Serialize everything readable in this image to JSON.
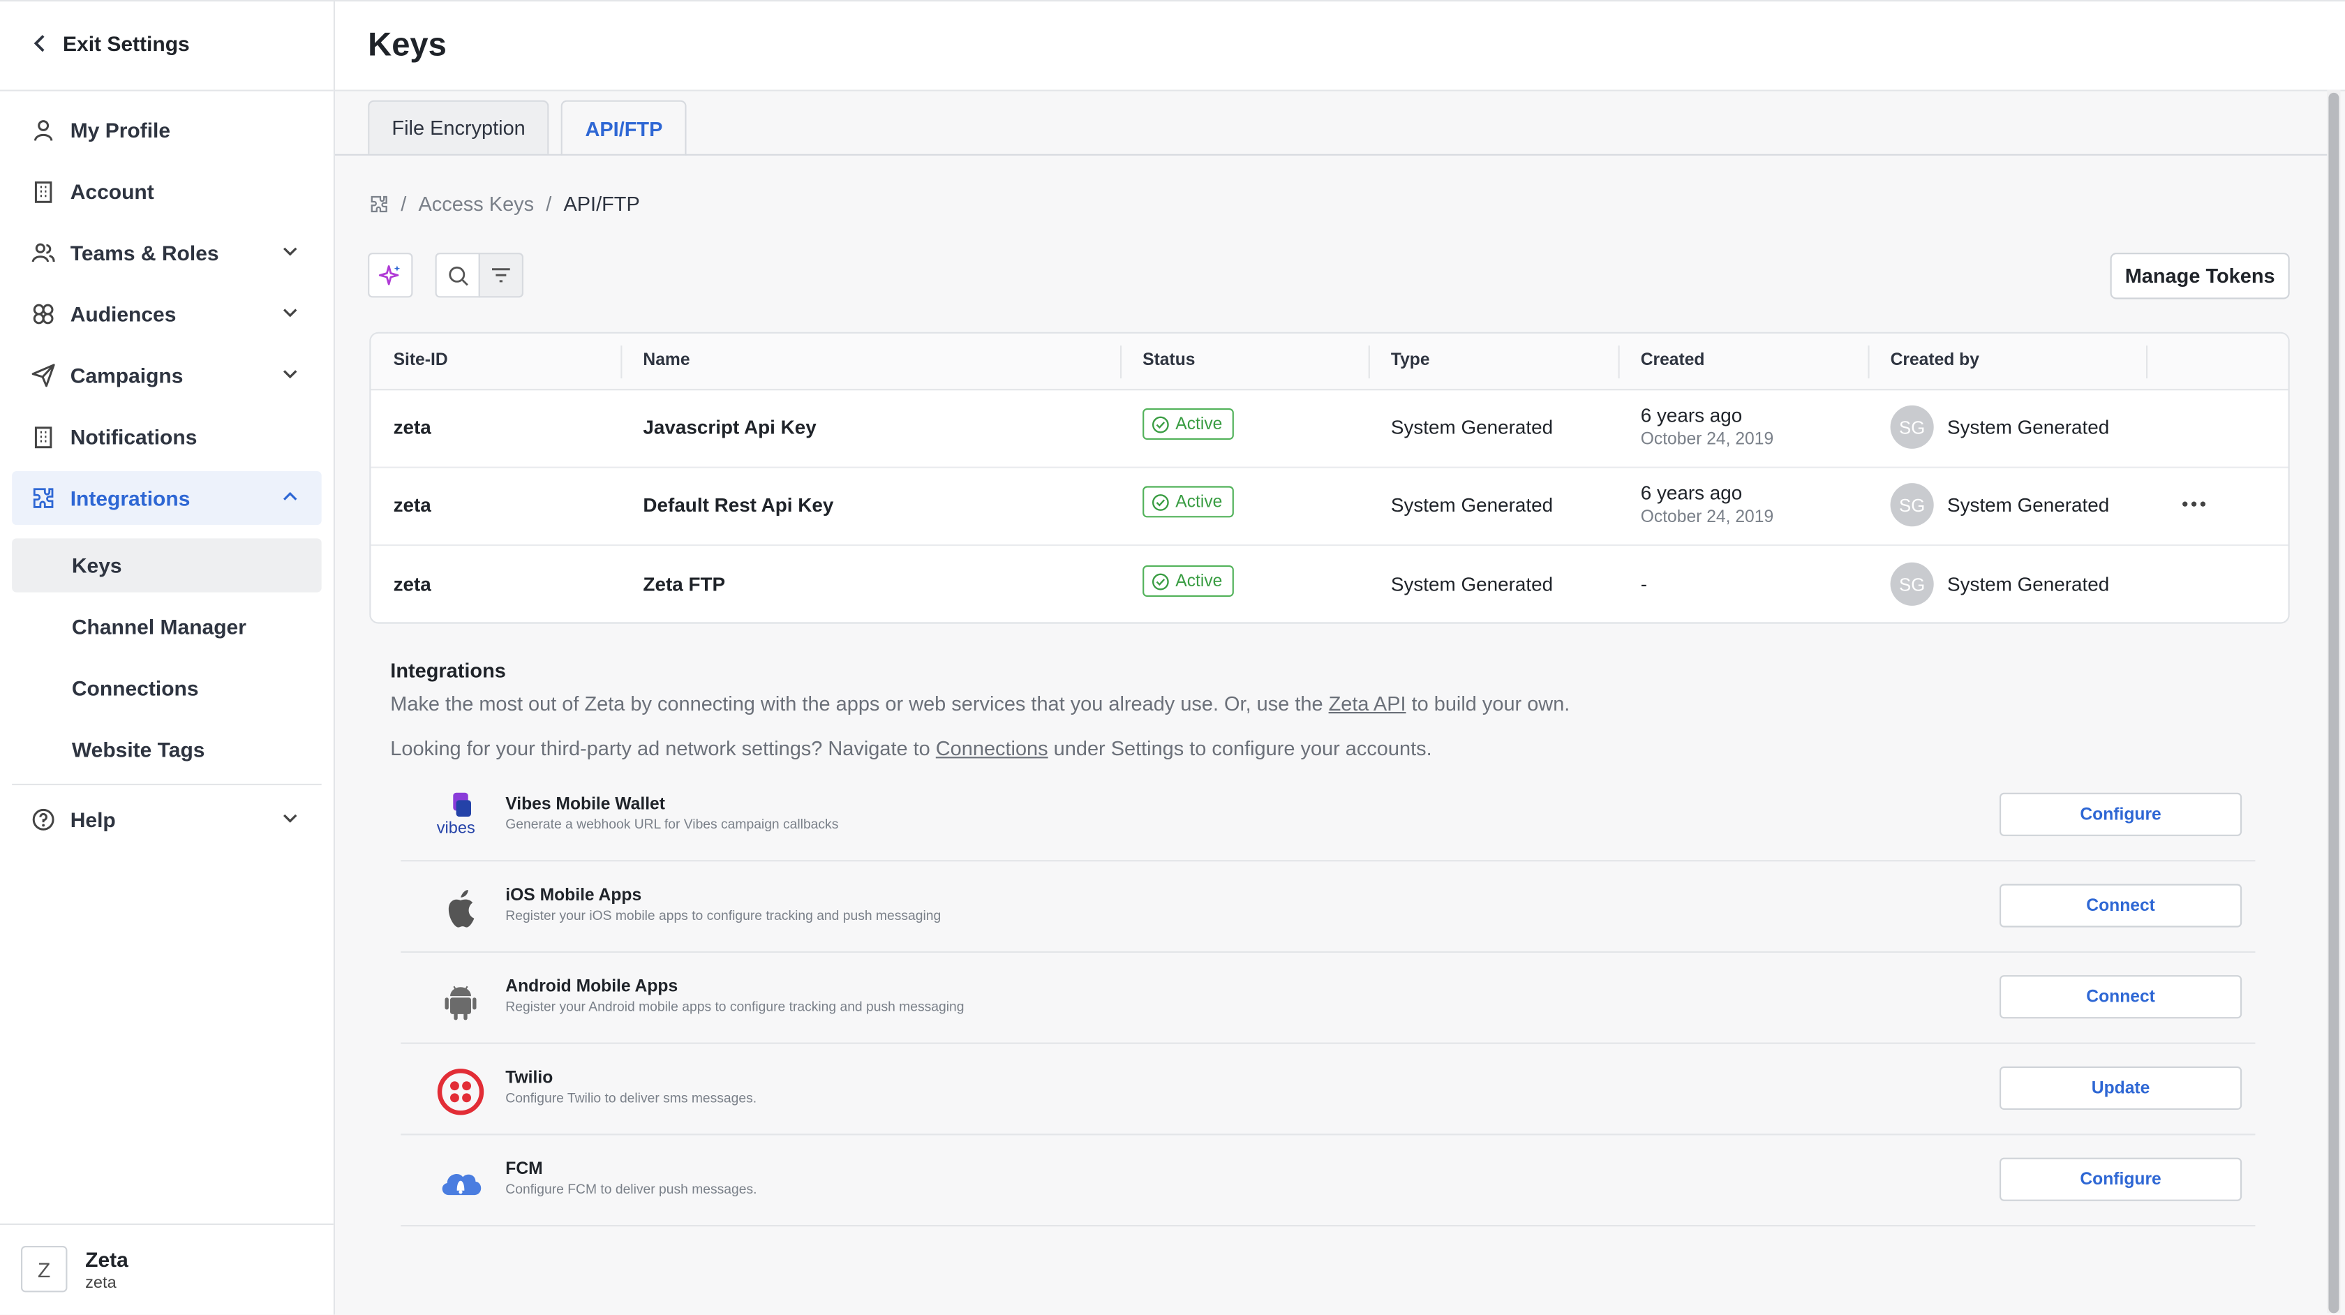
{
  "sidebar": {
    "exit_label": "Exit Settings",
    "items": [
      {
        "label": "My Profile",
        "icon": "user-icon"
      },
      {
        "label": "Account",
        "icon": "building-icon"
      },
      {
        "label": "Teams & Roles",
        "icon": "users-icon"
      },
      {
        "label": "Audiences",
        "icon": "audiences-icon"
      },
      {
        "label": "Campaigns",
        "icon": "send-icon"
      },
      {
        "label": "Notifications",
        "icon": "building-icon"
      },
      {
        "label": "Integrations",
        "icon": "puzzle-icon"
      }
    ],
    "sub_items": [
      "Keys",
      "Channel Manager",
      "Connections",
      "Website Tags"
    ],
    "help_label": "Help",
    "user": {
      "initial": "Z",
      "name": "Zeta",
      "org": "zeta"
    }
  },
  "header": {
    "title": "Keys"
  },
  "tabs": [
    {
      "label": "File Encryption"
    },
    {
      "label": "API/FTP"
    }
  ],
  "breadcrumb": {
    "parent": "Access Keys",
    "current": "API/FTP"
  },
  "toolbar": {
    "manage_label": "Manage Tokens"
  },
  "table": {
    "headers": [
      "Site-ID",
      "Name",
      "Status",
      "Type",
      "Created",
      "Created by"
    ],
    "rows": [
      {
        "site": "zeta",
        "name": "Javascript Api Key",
        "status": "Active",
        "type": "System Generated",
        "created": "6 years ago",
        "created_date": "October 24, 2019",
        "initials": "SG",
        "created_by": "System Generated"
      },
      {
        "site": "zeta",
        "name": "Default Rest Api Key",
        "status": "Active",
        "type": "System Generated",
        "created": "6 years ago",
        "created_date": "October 24, 2019",
        "initials": "SG",
        "created_by": "System Generated"
      },
      {
        "site": "zeta",
        "name": "Zeta FTP",
        "status": "Active",
        "type": "System Generated",
        "created": "-",
        "created_date": "",
        "initials": "SG",
        "created_by": "System Generated"
      }
    ]
  },
  "integrations": {
    "title": "Integrations",
    "desc1_pre": "Make the most out of Zeta by connecting with the apps or web services that you already use. Or, use the ",
    "desc1_link": "Zeta API",
    "desc1_post": " to build your own.",
    "desc2_pre": "Looking for your third-party ad network settings? Navigate to ",
    "desc2_link": "Connections",
    "desc2_post": " under Settings to configure your accounts.",
    "items": [
      {
        "title": "Vibes Mobile Wallet",
        "desc": "Generate a webhook URL for Vibes campaign callbacks",
        "action": "Configure",
        "icon": "vibes-logo-icon",
        "logo_text": "vibes"
      },
      {
        "title": "iOS Mobile Apps",
        "desc": "Register your iOS mobile apps to configure tracking and push messaging",
        "action": "Connect",
        "icon": "apple-icon"
      },
      {
        "title": "Android Mobile Apps",
        "desc": "Register your Android mobile apps to configure tracking and push messaging",
        "action": "Connect",
        "icon": "android-icon"
      },
      {
        "title": "Twilio",
        "desc": "Configure Twilio to deliver sms messages.",
        "action": "Update",
        "icon": "twilio-icon"
      },
      {
        "title": "FCM",
        "desc": "Configure FCM to deliver push messages.",
        "action": "Configure",
        "icon": "cloud-bell-icon"
      }
    ]
  },
  "colors": {
    "accent": "#2e67d4",
    "active_green": "#3a9d43",
    "twilio_red": "#e22d36"
  }
}
